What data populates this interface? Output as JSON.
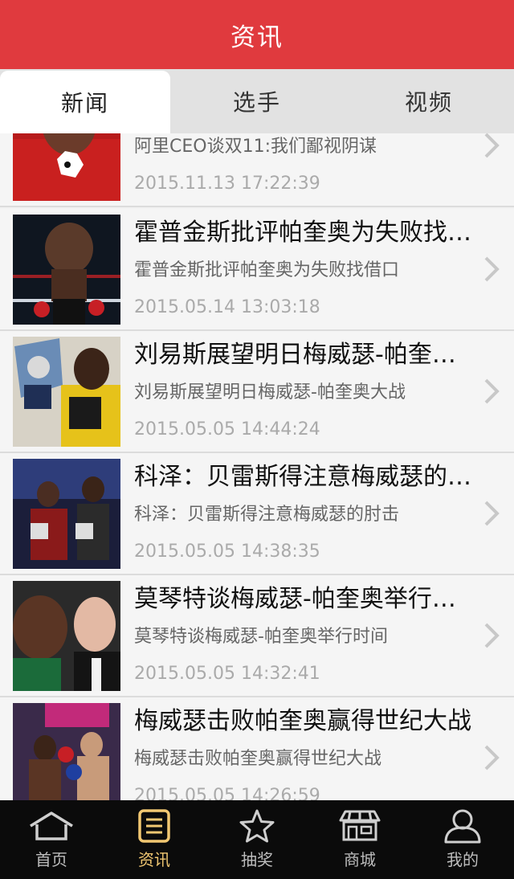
{
  "header": {
    "title": "资讯"
  },
  "tabs": [
    {
      "label": "新闻",
      "active": true
    },
    {
      "label": "选手",
      "active": false
    },
    {
      "label": "视频",
      "active": false
    }
  ],
  "news": [
    {
      "title": "",
      "summary": "阿里CEO谈双11:我们鄙视阴谋",
      "date": "2015.11.13 17:22:39"
    },
    {
      "title": "霍普金斯批评帕奎奥为失败找借口",
      "summary": "霍普金斯批评帕奎奥为失败找借口",
      "date": "2015.05.14 13:03:18"
    },
    {
      "title": "刘易斯展望明日梅威瑟-帕奎奥大战",
      "summary": "刘易斯展望明日梅威瑟-帕奎奥大战",
      "date": "2015.05.05 14:44:24"
    },
    {
      "title": "科泽：贝雷斯得注意梅威瑟的肘击",
      "summary": "科泽：贝雷斯得注意梅威瑟的肘击",
      "date": "2015.05.05 14:38:35"
    },
    {
      "title": "莫琴特谈梅威瑟-帕奎奥举行时间",
      "summary": "莫琴特谈梅威瑟-帕奎奥举行时间",
      "date": "2015.05.05 14:32:41"
    },
    {
      "title": "梅威瑟击败帕奎奥赢得世纪大战",
      "summary": "梅威瑟击败帕奎奥赢得世纪大战",
      "date": "2015.05.05 14:26:59"
    }
  ],
  "tabbar": [
    {
      "label": "首页",
      "icon": "home-icon",
      "active": false
    },
    {
      "label": "资讯",
      "icon": "news-icon",
      "active": true
    },
    {
      "label": "抽奖",
      "icon": "star-icon",
      "active": false
    },
    {
      "label": "商城",
      "icon": "store-icon",
      "active": false
    },
    {
      "label": "我的",
      "icon": "user-icon",
      "active": false
    }
  ],
  "colors": {
    "brand_red": "#e03a3e",
    "tab_active": "#f2c872",
    "tabbar_bg": "#0b0b0b"
  }
}
